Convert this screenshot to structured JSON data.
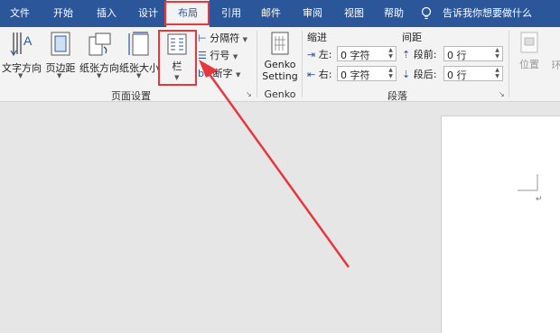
{
  "tabs": [
    "文件",
    "开始",
    "插入",
    "设计",
    "布局",
    "引用",
    "邮件",
    "审阅",
    "视图",
    "帮助"
  ],
  "tell_me": "告诉我你想要做什么",
  "page_setup": {
    "text_direction": "文字方向",
    "margins": "页边距",
    "orientation": "纸张方向",
    "size": "纸张大小",
    "columns": "栏",
    "breaks": "分隔符",
    "line_numbers": "行号",
    "hyphenation": "断字",
    "group_label": "页面设置"
  },
  "genko": {
    "line1": "Genko",
    "line2": "Setting",
    "group_label": "Genko"
  },
  "paragraph": {
    "indent_header": "缩进",
    "spacing_header": "间距",
    "left_label": "左:",
    "right_label": "右:",
    "before_label": "段前:",
    "after_label": "段后:",
    "left_value": "0 字符",
    "right_value": "0 字符",
    "before_value": "0 行",
    "after_value": "0 行",
    "group_label": "段落"
  },
  "arrange": {
    "position": "位置",
    "wrap": "环"
  },
  "colors": {
    "accent": "#2b579a",
    "highlight": "#e8363d"
  }
}
